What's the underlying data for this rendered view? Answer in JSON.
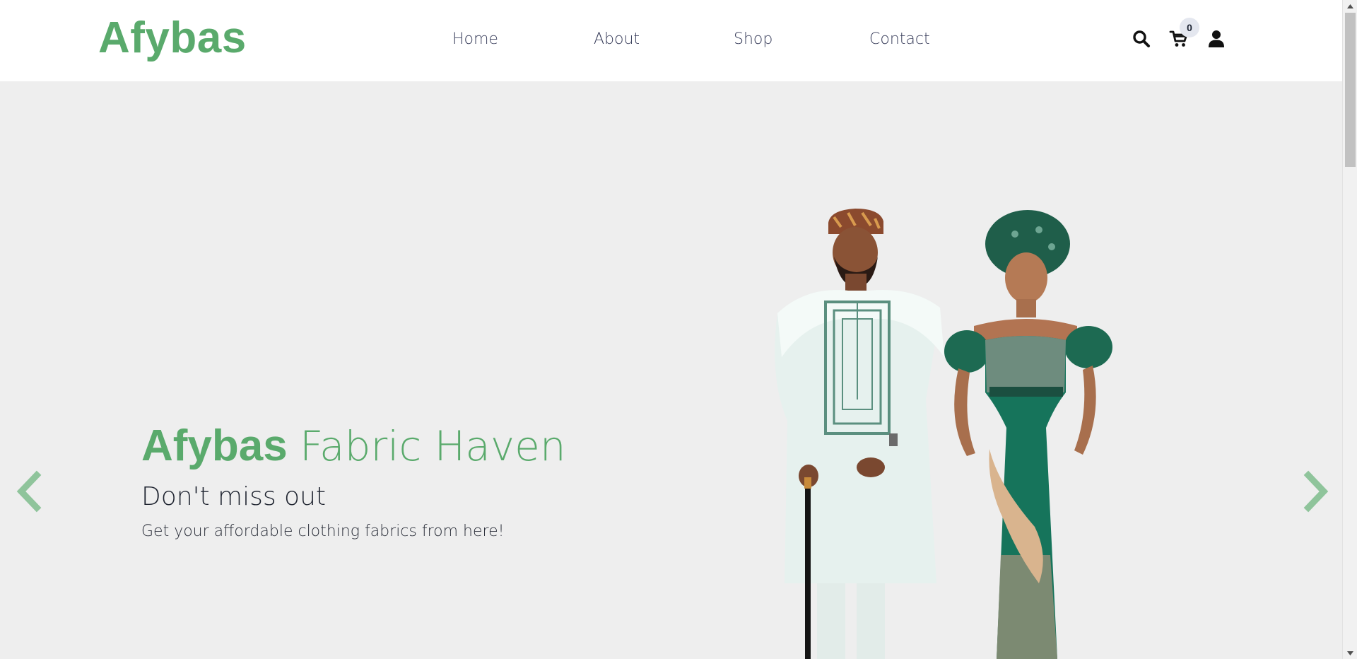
{
  "brand": {
    "name": "Afybas",
    "color": "#5aaa6c"
  },
  "nav": {
    "items": [
      {
        "label": "Home"
      },
      {
        "label": "About"
      },
      {
        "label": "Shop"
      },
      {
        "label": "Contact"
      }
    ]
  },
  "header_icons": {
    "search": "search-icon",
    "cart": "cart-icon",
    "user": "user-icon",
    "cart_count": "0"
  },
  "hero": {
    "title_strong": "Afybas",
    "title_light": "Fabric Haven",
    "subtitle": "Don't miss out",
    "text": "Get your affordable clothing fabrics from here!",
    "background": "#eeeeee",
    "arrow_color": "#8fc49b",
    "prev_icon": "chevron-left-icon",
    "next_icon": "chevron-right-icon",
    "image_alt": "Couple in traditional attire"
  }
}
